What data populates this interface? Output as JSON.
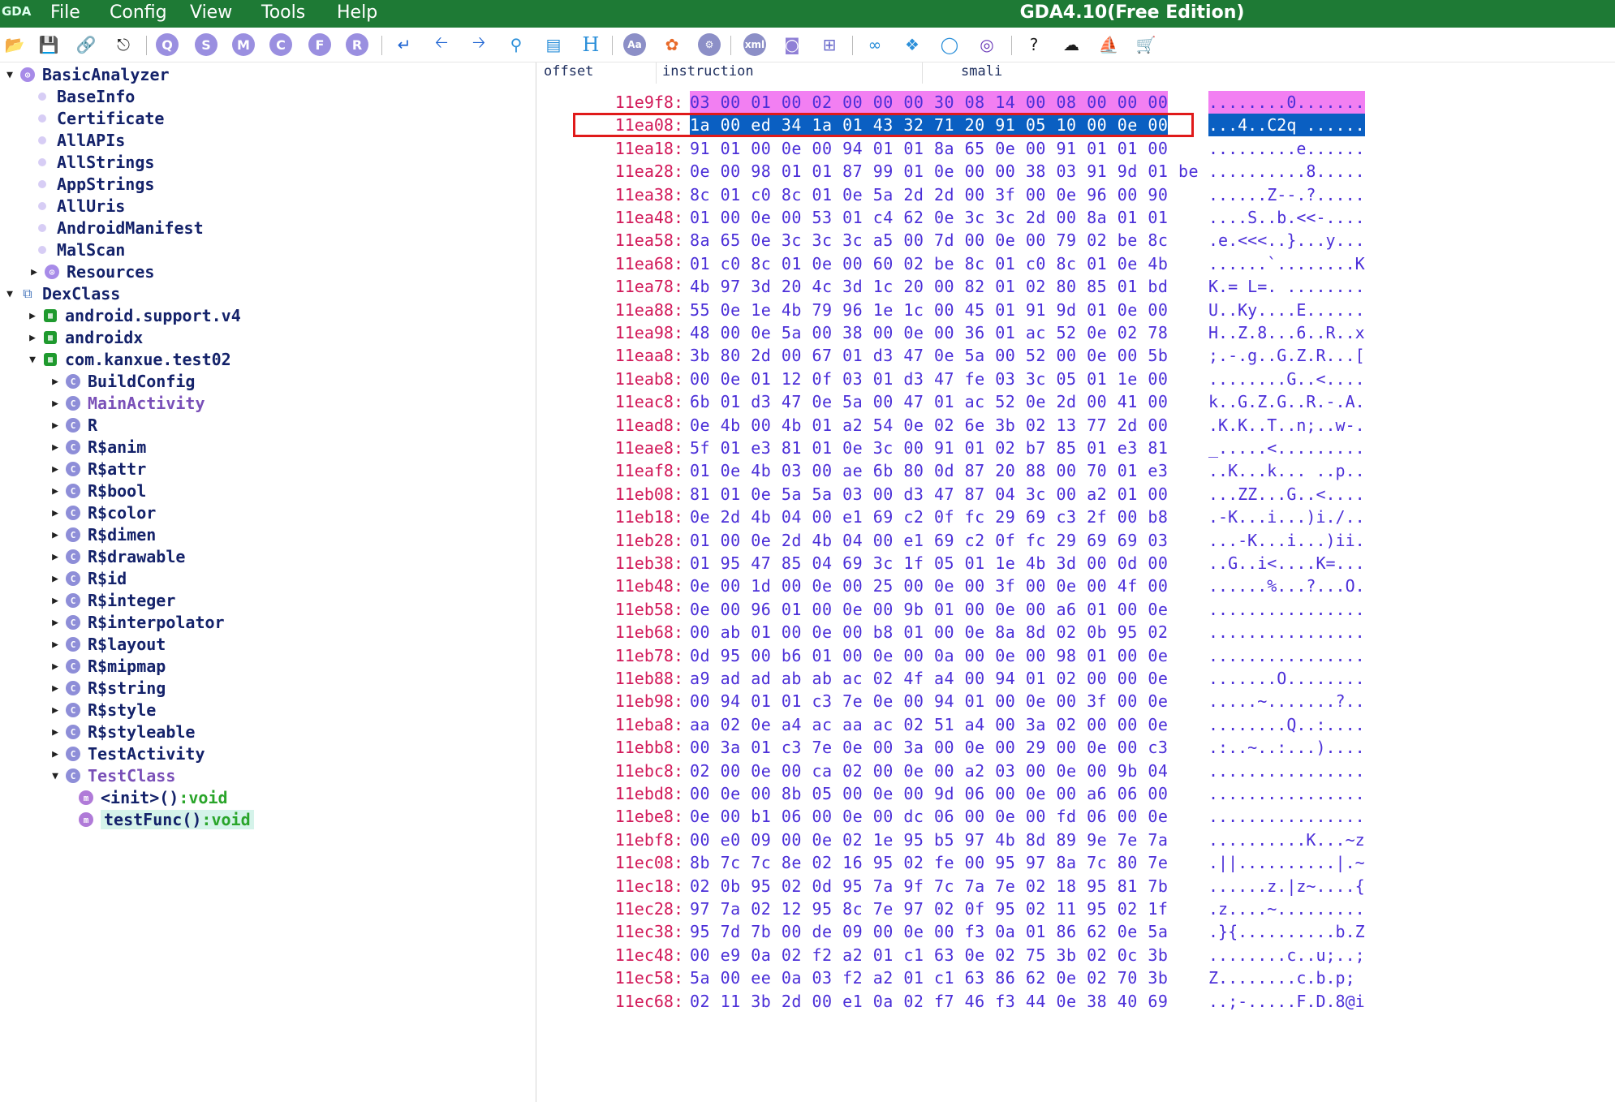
{
  "app": {
    "logo": "GDA",
    "title": "GDA4.10(Free Edition)",
    "menu": [
      "File",
      "Config",
      "View",
      "Tools",
      "Help"
    ]
  },
  "toolbar": {
    "circle_letters": [
      "Q",
      "S",
      "M",
      "C",
      "F",
      "R"
    ],
    "misc": [
      "H",
      "Aa",
      "xml",
      "?"
    ]
  },
  "tree": [
    {
      "label": "BasicAnalyzer",
      "kind": "purple",
      "expanded": "down"
    },
    {
      "label": "BaseInfo",
      "kind": "dot"
    },
    {
      "label": "Certificate",
      "kind": "dot"
    },
    {
      "label": "AllAPIs",
      "kind": "dot"
    },
    {
      "label": "AllStrings",
      "kind": "dot"
    },
    {
      "label": "AppStrings",
      "kind": "dot"
    },
    {
      "label": "AllUris",
      "kind": "dot"
    },
    {
      "label": "AndroidManifest",
      "kind": "dot"
    },
    {
      "label": "MalScan",
      "kind": "dot"
    },
    {
      "label": "Resources",
      "kind": "purple",
      "expanded": "right"
    },
    {
      "label": "DexClass",
      "kind": "dex",
      "expanded": "down"
    },
    {
      "label": "android.support.v4",
      "kind": "pkg",
      "expanded": "right"
    },
    {
      "label": "androidx",
      "kind": "pkg",
      "expanded": "right"
    },
    {
      "label": "com.kanxue.test02",
      "kind": "pkg",
      "expanded": "down"
    },
    {
      "label": "BuildConfig",
      "kind": "cls",
      "expanded": "right"
    },
    {
      "label": "MainActivity",
      "kind": "cls",
      "expanded": "right",
      "purple": true
    },
    {
      "label": "R",
      "kind": "cls",
      "expanded": "right"
    },
    {
      "label": "R$anim",
      "kind": "cls",
      "expanded": "right"
    },
    {
      "label": "R$attr",
      "kind": "cls",
      "expanded": "right"
    },
    {
      "label": "R$bool",
      "kind": "cls",
      "expanded": "right"
    },
    {
      "label": "R$color",
      "kind": "cls",
      "expanded": "right"
    },
    {
      "label": "R$dimen",
      "kind": "cls",
      "expanded": "right"
    },
    {
      "label": "R$drawable",
      "kind": "cls",
      "expanded": "right"
    },
    {
      "label": "R$id",
      "kind": "cls",
      "expanded": "right"
    },
    {
      "label": "R$integer",
      "kind": "cls",
      "expanded": "right"
    },
    {
      "label": "R$interpolator",
      "kind": "cls",
      "expanded": "right"
    },
    {
      "label": "R$layout",
      "kind": "cls",
      "expanded": "right"
    },
    {
      "label": "R$mipmap",
      "kind": "cls",
      "expanded": "right"
    },
    {
      "label": "R$string",
      "kind": "cls",
      "expanded": "right"
    },
    {
      "label": "R$style",
      "kind": "cls",
      "expanded": "right"
    },
    {
      "label": "R$styleable",
      "kind": "cls",
      "expanded": "right"
    },
    {
      "label": "TestActivity",
      "kind": "cls",
      "expanded": "right"
    },
    {
      "label": "TestClass",
      "kind": "cls",
      "expanded": "down",
      "purple": true
    },
    {
      "label": "<init>()",
      "rtype": ":void",
      "kind": "mth"
    },
    {
      "label": "testFunc()",
      "rtype": ":void",
      "kind": "mth",
      "selected": true
    }
  ],
  "hex": {
    "headers": [
      "offset",
      "instruction",
      "smali"
    ],
    "rows": [
      {
        "off": "11e9f8:",
        "bytes": "03 00 01 00 02 00 00 00 30 08 14 00 08 00 00 00",
        "ascii": "........0.......",
        "state": "hl"
      },
      {
        "off": "11ea08:",
        "bytes": "1a 00 ed 34 1a 01 43 32 71 20 91 05 10 00 0e 00",
        "ascii": "...4..C2q ......",
        "state": "sel"
      },
      {
        "off": "11ea18:",
        "bytes": "91 01 00 0e 00 94 01 01 8a 65 0e 00 91 01 01 00",
        "ascii": ".........e......"
      },
      {
        "off": "11ea28:",
        "bytes": "0e 00 98 01 01 87 99 01 0e 00 00 38 03 91 9d 01 be",
        "ascii": "..........8....."
      },
      {
        "off": "11ea38:",
        "bytes": "8c 01 c0 8c 01 0e 5a 2d 2d 00 3f 00 0e 96 00 90",
        "ascii": "......Z--.?....."
      },
      {
        "off": "11ea48:",
        "bytes": "01 00 0e 00 53 01 c4 62 0e 3c 3c 2d 00 8a 01 01",
        "ascii": "....S..b.<<-...."
      },
      {
        "off": "11ea58:",
        "bytes": "8a 65 0e 3c 3c 3c a5 00 7d 00 0e 00 79 02 be 8c",
        "ascii": ".e.<<<..}...y..."
      },
      {
        "off": "11ea68:",
        "bytes": "01 c0 8c 01 0e 00 60 02 be 8c 01 c0 8c 01 0e 4b",
        "ascii": "......`........K"
      },
      {
        "off": "11ea78:",
        "bytes": "4b 97 3d 20 4c 3d 1c 20 00 82 01 02 80 85 01 bd",
        "ascii": "K.= L=. ........"
      },
      {
        "off": "11ea88:",
        "bytes": "55 0e 1e 4b 79 96 1e 1c 00 45 01 91 9d 01 0e 00",
        "ascii": "U..Ky....E......"
      },
      {
        "off": "11ea98:",
        "bytes": "48 00 0e 5a 00 38 00 0e 00 36 01 ac 52 0e 02 78",
        "ascii": "H..Z.8...6..R..x"
      },
      {
        "off": "11eaa8:",
        "bytes": "3b 80 2d 00 67 01 d3 47 0e 5a 00 52 00 0e 00 5b",
        "ascii": ";.-.g..G.Z.R...["
      },
      {
        "off": "11eab8:",
        "bytes": "00 0e 01 12 0f 03 01 d3 47 fe 03 3c 05 01 1e 00",
        "ascii": "........G..<...."
      },
      {
        "off": "11eac8:",
        "bytes": "6b 01 d3 47 0e 5a 00 47 01 ac 52 0e 2d 00 41 00",
        "ascii": "k..G.Z.G..R.-.A."
      },
      {
        "off": "11ead8:",
        "bytes": "0e 4b 00 4b 01 a2 54 0e 02 6e 3b 02 13 77 2d 00",
        "ascii": ".K.K..T..n;..w-."
      },
      {
        "off": "11eae8:",
        "bytes": "5f 01 e3 81 01 0e 3c 00 91 01 02 b7 85 01 e3 81",
        "ascii": "_.....<........."
      },
      {
        "off": "11eaf8:",
        "bytes": "01 0e 4b 03 00 ae 6b 80 0d 87 20 88 00 70 01 e3",
        "ascii": "..K...k... ..p.."
      },
      {
        "off": "11eb08:",
        "bytes": "81 01 0e 5a 5a 03 00 d3 47 87 04 3c 00 a2 01 00",
        "ascii": "...ZZ...G..<...."
      },
      {
        "off": "11eb18:",
        "bytes": "0e 2d 4b 04 00 e1 69 c2 0f fc 29 69 c3 2f 00 b8",
        "ascii": ".-K...i...)i./.."
      },
      {
        "off": "11eb28:",
        "bytes": "01 00 0e 2d 4b 04 00 e1 69 c2 0f fc 29 69 69 03",
        "ascii": "...-K...i...)ii."
      },
      {
        "off": "11eb38:",
        "bytes": "01 95 47 85 04 69 3c 1f 05 01 1e 4b 3d 00 0d 00",
        "ascii": "..G..i<....K=..."
      },
      {
        "off": "11eb48:",
        "bytes": "0e 00 1d 00 0e 00 25 00 0e 00 3f 00 0e 00 4f 00",
        "ascii": "......%...?...O."
      },
      {
        "off": "11eb58:",
        "bytes": "0e 00 96 01 00 0e 00 9b 01 00 0e 00 a6 01 00 0e",
        "ascii": "................"
      },
      {
        "off": "11eb68:",
        "bytes": "00 ab 01 00 0e 00 b8 01 00 0e 8a 8d 02 0b 95 02",
        "ascii": "................"
      },
      {
        "off": "11eb78:",
        "bytes": "0d 95 00 b6 01 00 0e 00 0a 00 0e 00 98 01 00 0e",
        "ascii": "................"
      },
      {
        "off": "11eb88:",
        "bytes": "a9 ad ad ab ab ac 02 4f a4 00 94 01 02 00 00 0e",
        "ascii": ".......O........"
      },
      {
        "off": "11eb98:",
        "bytes": "00 94 01 01 c3 7e 0e 00 94 01 00 0e 00 3f 00 0e",
        "ascii": ".....~.......?.."
      },
      {
        "off": "11eba8:",
        "bytes": "aa 02 0e a4 ac aa ac 02 51 a4 00 3a 02 00 00 0e",
        "ascii": "........Q..:...."
      },
      {
        "off": "11ebb8:",
        "bytes": "00 3a 01 c3 7e 0e 00 3a 00 0e 00 29 00 0e 00 c3",
        "ascii": ".:..~..:...)...."
      },
      {
        "off": "11ebc8:",
        "bytes": "02 00 0e 00 ca 02 00 0e 00 a2 03 00 0e 00 9b 04",
        "ascii": "................"
      },
      {
        "off": "11ebd8:",
        "bytes": "00 0e 00 8b 05 00 0e 00 9d 06 00 0e 00 a6 06 00",
        "ascii": "................"
      },
      {
        "off": "11ebe8:",
        "bytes": "0e 00 b1 06 00 0e 00 dc 06 00 0e 00 fd 06 00 0e",
        "ascii": "................"
      },
      {
        "off": "11ebf8:",
        "bytes": "00 e0 09 00 0e 02 1e 95 b5 97 4b 8d 89 9e 7e 7a",
        "ascii": "..........K...~z"
      },
      {
        "off": "11ec08:",
        "bytes": "8b 7c 7c 8e 02 16 95 02 fe 00 95 97 8a 7c 80 7e",
        "ascii": ".||..........|.~"
      },
      {
        "off": "11ec18:",
        "bytes": "02 0b 95 02 0d 95 7a 9f 7c 7a 7e 02 18 95 81 7b",
        "ascii": "......z.|z~....{"
      },
      {
        "off": "11ec28:",
        "bytes": "97 7a 02 12 95 8c 7e 97 02 0f 95 02 11 95 02 1f",
        "ascii": ".z....~........."
      },
      {
        "off": "11ec38:",
        "bytes": "95 7d 7b 00 de 09 00 0e 00 f3 0a 01 86 62 0e 5a",
        "ascii": ".}{..........b.Z"
      },
      {
        "off": "11ec48:",
        "bytes": "00 e9 0a 02 f2 a2 01 c1 63 0e 02 75 3b 02 0c 3b",
        "ascii": "........c..u;..;"
      },
      {
        "off": "11ec58:",
        "bytes": "5a 00 ee 0a 03 f2 a2 01 c1 63 86 62 0e 02 70 3b",
        "ascii": "Z........c.b.p;"
      },
      {
        "off": "11ec68:",
        "bytes": "02 11 3b 2d 00 e1 0a 02 f7 46 f3 44 0e 38 40 69",
        "ascii": "..;-.....F.D.8@i"
      }
    ]
  },
  "colors": {
    "titlebar": "#1e7a35",
    "offset": "#d21a5a",
    "bytes": "#4b2fd8",
    "highlight_row": "#f27ff2",
    "selected_row": "#0a5fc2",
    "selection_border": "#e01a1a"
  }
}
